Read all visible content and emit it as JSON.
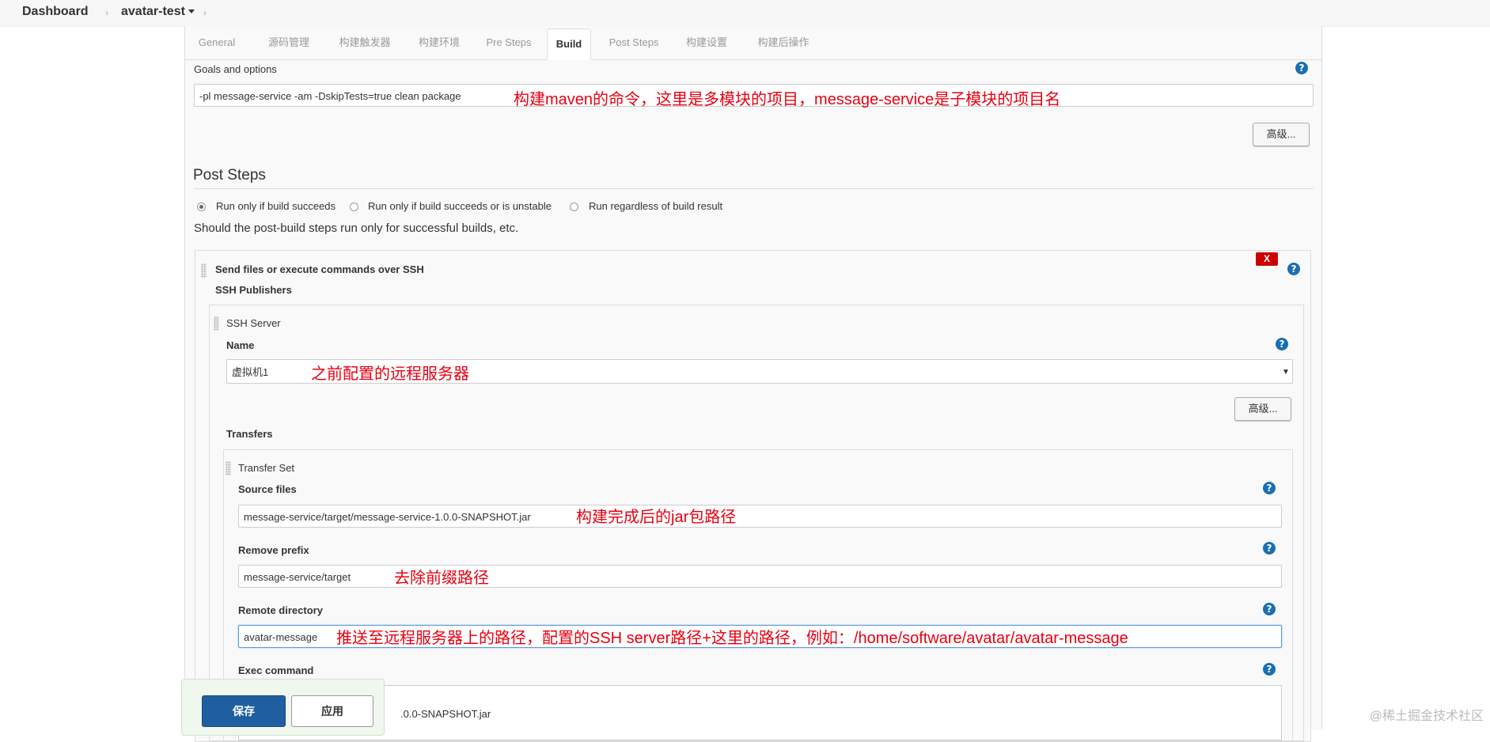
{
  "breadcrumb": {
    "dashboard": "Dashboard",
    "job": "avatar-test"
  },
  "tabs": [
    "General",
    "源码管理",
    "构建触发器",
    "构建环境",
    "Pre Steps",
    "Build",
    "Post Steps",
    "构建设置",
    "构建后操作"
  ],
  "active_tab": "Build",
  "build": {
    "goals_label": "Goals and options",
    "goals_value": "-pl message-service -am -DskipTests=true clean package",
    "goals_annotation": "构建maven的命令，这里是多模块的项目，message-service是子模块的项目名",
    "advanced_label": "高级..."
  },
  "post_steps": {
    "title": "Post Steps",
    "radio_options": [
      "Run only if build succeeds",
      "Run only if build succeeds or is unstable",
      "Run regardless of build result"
    ],
    "selected_index": 0,
    "description": "Should the post-build steps run only for successful builds, etc."
  },
  "ssh": {
    "step_title": "Send files or execute commands over SSH",
    "delete_label": "X",
    "publishers_label": "SSH Publishers",
    "server_label": "SSH Server",
    "name_label": "Name",
    "name_value": "虚拟机1",
    "name_annotation": "之前配置的远程服务器",
    "advanced_label": "高级...",
    "transfers_label": "Transfers",
    "transfer_set_label": "Transfer Set",
    "source_files_label": "Source files",
    "source_files_value": "message-service/target/message-service-1.0.0-SNAPSHOT.jar",
    "source_files_annotation": "构建完成后的jar包路径",
    "remove_prefix_label": "Remove prefix",
    "remove_prefix_value": "message-service/target",
    "remove_prefix_annotation": "去除前缀路径",
    "remote_dir_label": "Remote directory",
    "remote_dir_value": "avatar-message",
    "remote_dir_annotation": "推送至远程服务器上的路径，配置的SSH server路径+这里的路径，例如：/home/software/avatar/avatar-message",
    "exec_command_label": "Exec command",
    "exec_command_visible": ".0.0-SNAPSHOT.jar"
  },
  "footer": {
    "save_label": "保存",
    "apply_label": "应用"
  },
  "watermark": "@稀土掘金技术社区",
  "help_icon_glyph": "?"
}
